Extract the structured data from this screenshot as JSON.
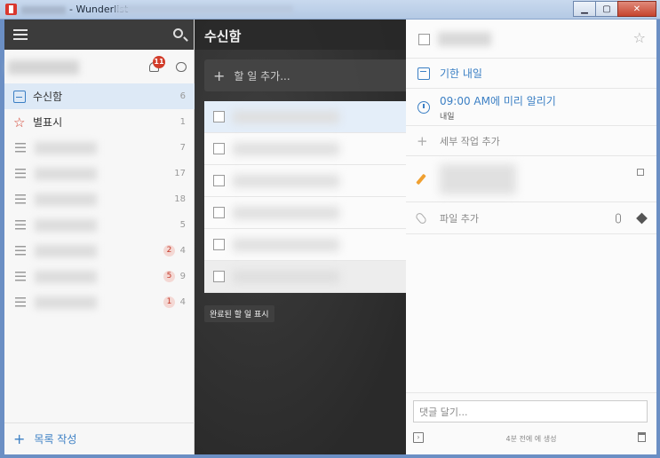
{
  "window": {
    "title": "- Wunderlist",
    "controls": {
      "minimize": "▁",
      "maximize": "▢",
      "close": "✕"
    }
  },
  "sidebar": {
    "notification_count": "11",
    "lists": [
      {
        "label": "수신함",
        "count": "6",
        "icon": "inbox-icon",
        "active": true
      },
      {
        "label": "별표시",
        "count": "1",
        "icon": "star-icon"
      },
      {
        "label": "",
        "count": "7",
        "icon": "list-icon"
      },
      {
        "label": "",
        "count": "17",
        "icon": "list-icon"
      },
      {
        "label": "",
        "count": "18",
        "icon": "list-icon"
      },
      {
        "label": "",
        "count": "5",
        "icon": "list-icon"
      },
      {
        "label": "",
        "count": "4",
        "badge": "2",
        "icon": "list-icon"
      },
      {
        "label": "",
        "count": "9",
        "badge": "5",
        "icon": "list-icon"
      },
      {
        "label": "",
        "count": "4",
        "badge": "1",
        "icon": "list-icon"
      }
    ],
    "create_list_label": "목록 작성"
  },
  "middle": {
    "title": "수신함",
    "add_todo_placeholder": "할 일 추가...",
    "show_completed_label": "완료된 할 일 표시"
  },
  "detail": {
    "due_label": "기한 내일",
    "reminder_label": "09:00 AM에 미리 알리기",
    "reminder_sub": "내일",
    "subtask_label": "세부 작업 추가",
    "file_label": "파일 추가",
    "comment_placeholder": "댓글 달기...",
    "created_label": "4분 전에 에 생성"
  },
  "colors": {
    "accent": "#3b7fc4",
    "badge": "#d23c2a",
    "dark_panel": "#2e2e2e"
  }
}
